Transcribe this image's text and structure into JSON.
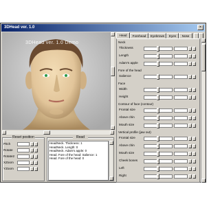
{
  "window": {
    "title": "3DHead ver. 1.0",
    "close_glyph": "×"
  },
  "viewport": {
    "watermark": "3DHead ver. 1.0 Demo"
  },
  "reset_panel": {
    "title": "Reset position",
    "rows": [
      "Pitch",
      "Rotate",
      "Rotate2",
      "XZoom",
      "YZoom"
    ]
  },
  "log_panel": {
    "title": "Read",
    "lines": [
      "HeadNeck. Thickness: 1",
      "HeadNeck. Length: 0",
      "HeadNeck. Adam's apple: 0",
      "Head. Fore of the head: Salience: 1",
      "Head. Fore of the head: 0"
    ]
  },
  "tabs": [
    "Head",
    "Forehead",
    "Eyebrows",
    "Eyes",
    "Nose"
  ],
  "properties": {
    "neck_section": "Neck",
    "neck": [
      "Thickness",
      "Length",
      "Adam's apple"
    ],
    "fore_section": "Fore of the head",
    "fore": [
      "Salience"
    ],
    "face_section": "Face",
    "face": [
      "Width",
      "Height"
    ],
    "contour_section": "Contour of face (contour)",
    "contour": [
      "Frontal size",
      "Above chin",
      "Mouth size"
    ],
    "profile_section": "Vertical profile (jaw out)",
    "profile": [
      "Frontal size",
      "Above chin",
      "Mouth size",
      "Cheek bones",
      "Left",
      "Right"
    ]
  },
  "colors": {
    "title_start": "#0a246a",
    "title_end": "#a6caf0",
    "face_bg": "#d4d0c8"
  }
}
